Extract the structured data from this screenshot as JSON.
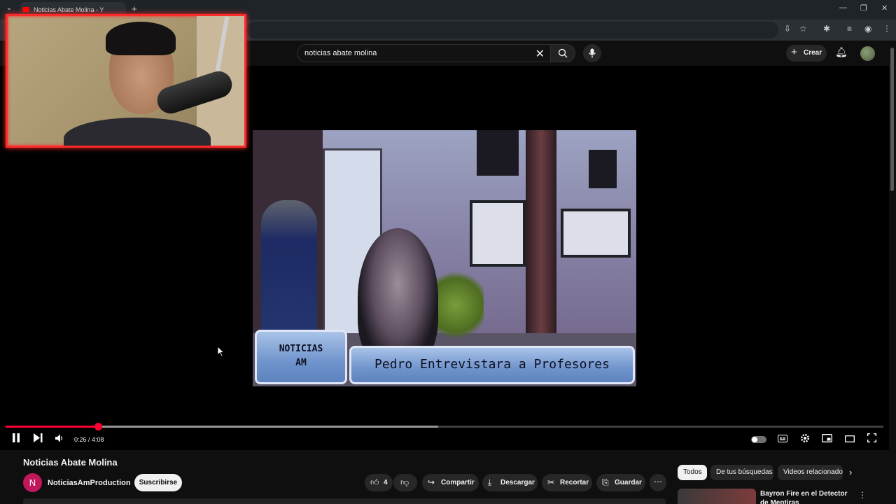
{
  "browser": {
    "tab_title": "Noticias Abate Molina - YouTube",
    "new_tab": "+",
    "minimize": "—",
    "restore": "❐",
    "close": "✕"
  },
  "header": {
    "search_value": "noticias abate molina",
    "create_label": "Crear"
  },
  "player": {
    "caption_left_line1": "NOTICIAS",
    "caption_left_line2": "AM",
    "caption_right": "Pedro Entrevistara a Profesores",
    "time_display": "0:26 / 4:08",
    "played_fraction": 0.105,
    "buffered_fraction": 0.493
  },
  "video": {
    "title": "Noticias Abate Molina",
    "channel_initial": "N",
    "channel_name": "NoticiasAmProduction",
    "subscribe_label": "Suscribirse",
    "like_count": "4",
    "share_label": "Compartir",
    "download_label": "Descargar",
    "clip_label": "Recortar",
    "save_label": "Guardar"
  },
  "chips": [
    {
      "label": "Todos",
      "active": true
    },
    {
      "label": "De tus búsquedas",
      "active": false
    },
    {
      "label": "Videos relacionados",
      "active": false
    }
  ],
  "recommendation": {
    "title": "Bayron Fire en el Detector de Mentiras"
  },
  "colors": {
    "accent_red": "#ff0033",
    "webcam_border": "#ff2a2a",
    "background": "#0f0f0f"
  }
}
